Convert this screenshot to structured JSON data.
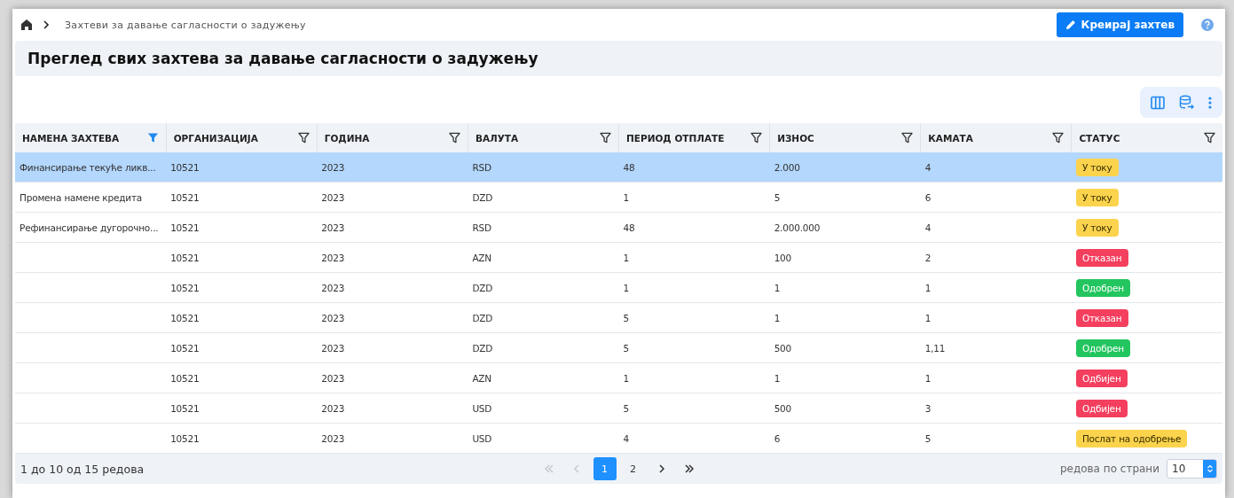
{
  "breadcrumb": {
    "current": "Захтеви за давање сагласности о задужењу"
  },
  "create_button": {
    "label": "Креирај захтев"
  },
  "title": "Преглед свих захтева за давање сагласности о задужењу",
  "table": {
    "columns": [
      {
        "label": "НАМЕНА ЗАХТЕВА",
        "filter_active": true
      },
      {
        "label": "ОРГАНИЗАЦИЈА",
        "filter_active": false
      },
      {
        "label": "ГОДИНА",
        "filter_active": false
      },
      {
        "label": "ВАЛУТА",
        "filter_active": false
      },
      {
        "label": "ПЕРИОД ОТПЛАТЕ",
        "filter_active": false
      },
      {
        "label": "ИЗНОС",
        "filter_active": false
      },
      {
        "label": "КАМАТА",
        "filter_active": false
      },
      {
        "label": "СТАТУС",
        "filter_active": false
      }
    ],
    "rows": [
      {
        "selected": true,
        "cells": [
          "Финансирање текуће ликв...",
          "10521",
          "2023",
          "RSD",
          "48",
          "2.000",
          "4"
        ],
        "status": {
          "label": "У току",
          "kind": "pending"
        }
      },
      {
        "selected": false,
        "cells": [
          "Промена намене кредита",
          "10521",
          "2023",
          "DZD",
          "1",
          "5",
          "6"
        ],
        "status": {
          "label": "У току",
          "kind": "pending"
        }
      },
      {
        "selected": false,
        "cells": [
          "Рефинансирање дугорочно...",
          "10521",
          "2023",
          "RSD",
          "48",
          "2.000.000",
          "4"
        ],
        "status": {
          "label": "У току",
          "kind": "pending"
        }
      },
      {
        "selected": false,
        "cells": [
          "",
          "10521",
          "2023",
          "AZN",
          "1",
          "100",
          "2"
        ],
        "status": {
          "label": "Отказан",
          "kind": "negative"
        }
      },
      {
        "selected": false,
        "cells": [
          "",
          "10521",
          "2023",
          "DZD",
          "1",
          "1",
          "1"
        ],
        "status": {
          "label": "Одобрен",
          "kind": "positive"
        }
      },
      {
        "selected": false,
        "cells": [
          "",
          "10521",
          "2023",
          "DZD",
          "5",
          "1",
          "1"
        ],
        "status": {
          "label": "Отказан",
          "kind": "negative"
        }
      },
      {
        "selected": false,
        "cells": [
          "",
          "10521",
          "2023",
          "DZD",
          "5",
          "500",
          "1,11"
        ],
        "status": {
          "label": "Одобрен",
          "kind": "positive"
        }
      },
      {
        "selected": false,
        "cells": [
          "",
          "10521",
          "2023",
          "AZN",
          "1",
          "1",
          "1"
        ],
        "status": {
          "label": "Одбијен",
          "kind": "negative"
        }
      },
      {
        "selected": false,
        "cells": [
          "",
          "10521",
          "2023",
          "USD",
          "5",
          "500",
          "3"
        ],
        "status": {
          "label": "Одбијен",
          "kind": "negative"
        }
      },
      {
        "selected": false,
        "cells": [
          "",
          "10521",
          "2023",
          "USD",
          "4",
          "6",
          "5"
        ],
        "status": {
          "label": "Послат на одобрење",
          "kind": "pending"
        }
      }
    ]
  },
  "footer": {
    "summary": "1 до 10 од 15 редова",
    "nav": [
      {
        "kind": "first",
        "disabled": true
      },
      {
        "kind": "prev",
        "disabled": true
      }
    ],
    "pages": [
      {
        "label": "1",
        "selected": true
      },
      {
        "label": "2",
        "selected": false
      }
    ],
    "nav_after": [
      {
        "kind": "next",
        "disabled": false
      },
      {
        "kind": "last",
        "disabled": false
      }
    ],
    "rows_per_page_label": "редова по страни",
    "rows_per_page": "10"
  }
}
